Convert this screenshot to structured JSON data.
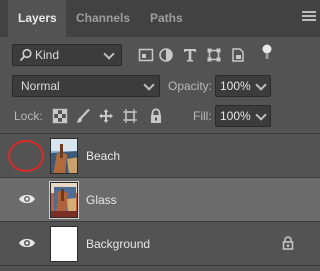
{
  "tabs": [
    {
      "label": "Layers"
    },
    {
      "label": "Channels"
    },
    {
      "label": "Paths"
    }
  ],
  "filter": {
    "kind_label": "Kind"
  },
  "blend": {
    "mode": "Normal",
    "opacity_label": "Opacity:",
    "opacity_value": "100%"
  },
  "lock": {
    "label": "Lock:",
    "fill_label": "Fill:",
    "fill_value": "100%"
  },
  "layers": [
    {
      "name": "Beach",
      "visible": false,
      "selected": false,
      "locked": false
    },
    {
      "name": "Glass",
      "visible": true,
      "selected": true,
      "locked": false
    },
    {
      "name": "Background",
      "visible": true,
      "selected": false,
      "locked": true
    }
  ],
  "colors": {
    "annotation": "#d82a26",
    "panel_bg": "#535353",
    "selected_row": "#6b6b6b"
  }
}
